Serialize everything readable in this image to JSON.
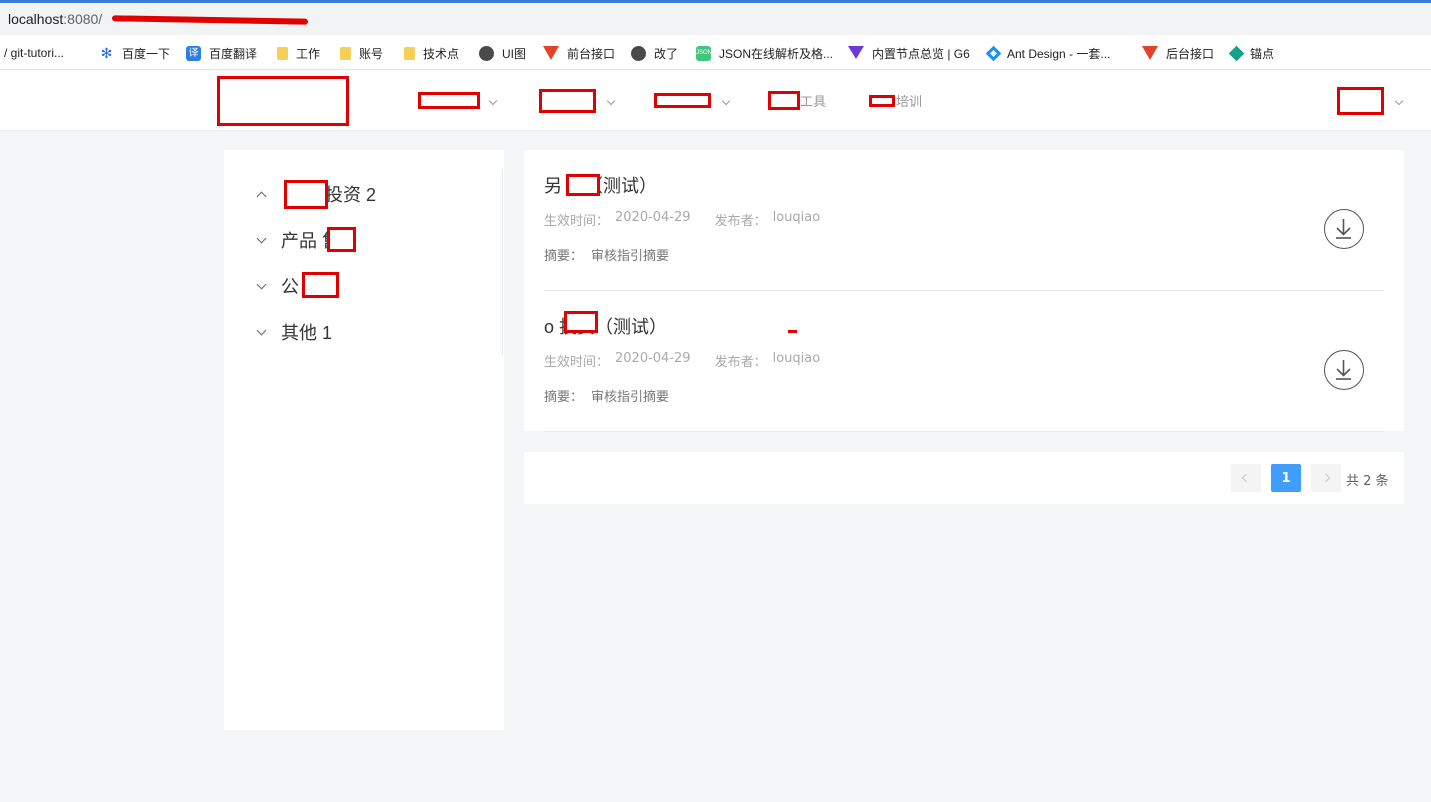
{
  "browser": {
    "url_host": "localhost",
    "url_rest": ":8080/",
    "bookmarks": [
      {
        "icon": "github-icon",
        "label": "/ git-tutori..."
      },
      {
        "icon": "baidu-icon",
        "label": "百度一下"
      },
      {
        "icon": "fanyi-icon",
        "label": "百度翻译"
      },
      {
        "icon": "folder-icon",
        "label": "工作"
      },
      {
        "icon": "folder-icon",
        "label": "账号"
      },
      {
        "icon": "folder-icon",
        "label": "技术点"
      },
      {
        "icon": "globe-icon",
        "label": "UI图"
      },
      {
        "icon": "gitlab-icon",
        "label": "前台接口"
      },
      {
        "icon": "globe-icon",
        "label": "改了"
      },
      {
        "icon": "json-icon",
        "label": "JSON在线解析及格..."
      },
      {
        "icon": "vue-icon",
        "label": "内置节点总览 | G6"
      },
      {
        "icon": "ant-design-icon",
        "label": "Ant Design - 一套..."
      },
      {
        "icon": "gitlab-icon",
        "label": "后台接口"
      },
      {
        "icon": "anchor-icon",
        "label": "锚点"
      }
    ]
  },
  "header": {
    "nav": [
      {
        "label": ""
      },
      {
        "label": ""
      },
      {
        "label": ""
      },
      {
        "label": "工具"
      },
      {
        "label": "培训"
      }
    ]
  },
  "sidebar": {
    "items": [
      {
        "label": "投资 2",
        "expanded": true
      },
      {
        "label": "产品  售 1",
        "expanded": false
      },
      {
        "label": "公   场 1",
        "expanded": false
      },
      {
        "label": "其他 1",
        "expanded": false
      }
    ]
  },
  "articles": [
    {
      "title": "另   资（测试）",
      "date_label": "生效时间：",
      "date": "2020-04-29",
      "author_label": "发布者：",
      "author": "louqiao",
      "summary_label": "摘要：",
      "summary": "审核指引摘要"
    },
    {
      "title": "o    投资（测试）",
      "date_label": "生效时间：",
      "date": "2020-04-29",
      "author_label": "发布者：",
      "author": "louqiao",
      "summary_label": "摘要：",
      "summary": "审核指引摘要"
    }
  ],
  "pagination": {
    "current": "1",
    "total_text": "共 2 条"
  },
  "colors": {
    "accent": "#409eff",
    "redaction": "#e00000",
    "background": "#f5f6f8"
  }
}
